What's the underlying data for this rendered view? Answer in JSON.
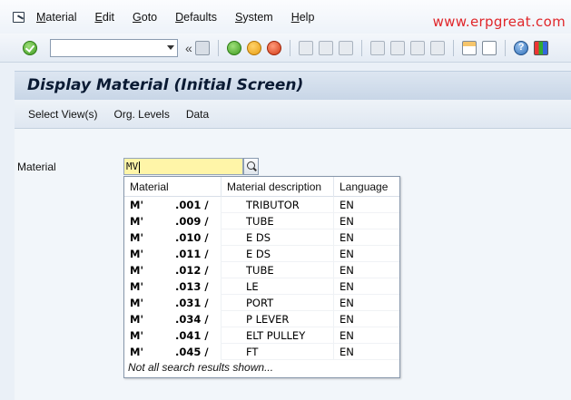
{
  "menubar": {
    "items": [
      "Material",
      "Edit",
      "Goto",
      "Defaults",
      "System",
      "Help"
    ],
    "underline": [
      "M",
      "E",
      "G",
      "D",
      "S",
      "H"
    ],
    "watermark": "www.erpgreat.com"
  },
  "toolbar": {
    "command_field_value": "",
    "icons": [
      "enter-icon",
      "save-icon",
      "back-icon",
      "exit-icon",
      "cancel-icon",
      "print-icon",
      "find-icon",
      "find-next-icon",
      "first-page-icon",
      "previous-page-icon",
      "next-page-icon",
      "last-page-icon",
      "create-session-icon",
      "shortcut-icon",
      "help-icon",
      "customize-layout-icon"
    ]
  },
  "title": "Display Material (Initial Screen)",
  "app_toolbar": {
    "buttons": [
      "Select View(s)",
      "Org. Levels",
      "Data"
    ]
  },
  "form": {
    "material_label": "Material",
    "material_value": "MV"
  },
  "search_help": {
    "columns": [
      "Material",
      "Material description",
      "Language"
    ],
    "rows": [
      {
        "material_prefix": "M'",
        "material_suffix": ".001 /",
        "description": "TRIBUTOR",
        "language": "EN"
      },
      {
        "material_prefix": "M'",
        "material_suffix": ".009 /",
        "description": "TUBE",
        "language": "EN"
      },
      {
        "material_prefix": "M'",
        "material_suffix": ".010 /",
        "description": "E DS",
        "language": "EN"
      },
      {
        "material_prefix": "M'",
        "material_suffix": ".011 /",
        "description": "E DS",
        "language": "EN"
      },
      {
        "material_prefix": "M'",
        "material_suffix": ".012 /",
        "description": "TUBE",
        "language": "EN"
      },
      {
        "material_prefix": "M'",
        "material_suffix": ".013 /",
        "description": "LE",
        "language": "EN"
      },
      {
        "material_prefix": "M'",
        "material_suffix": ".031 /",
        "description": "PORT",
        "language": "EN"
      },
      {
        "material_prefix": "M'",
        "material_suffix": ".034 /",
        "description": "P LEVER",
        "language": "EN"
      },
      {
        "material_prefix": "M'",
        "material_suffix": ".041 /",
        "description": "ELT PULLEY",
        "language": "EN"
      },
      {
        "material_prefix": "M'",
        "material_suffix": ".045 /",
        "description": "FT",
        "language": "EN"
      }
    ],
    "footer": "Not all search results shown..."
  }
}
